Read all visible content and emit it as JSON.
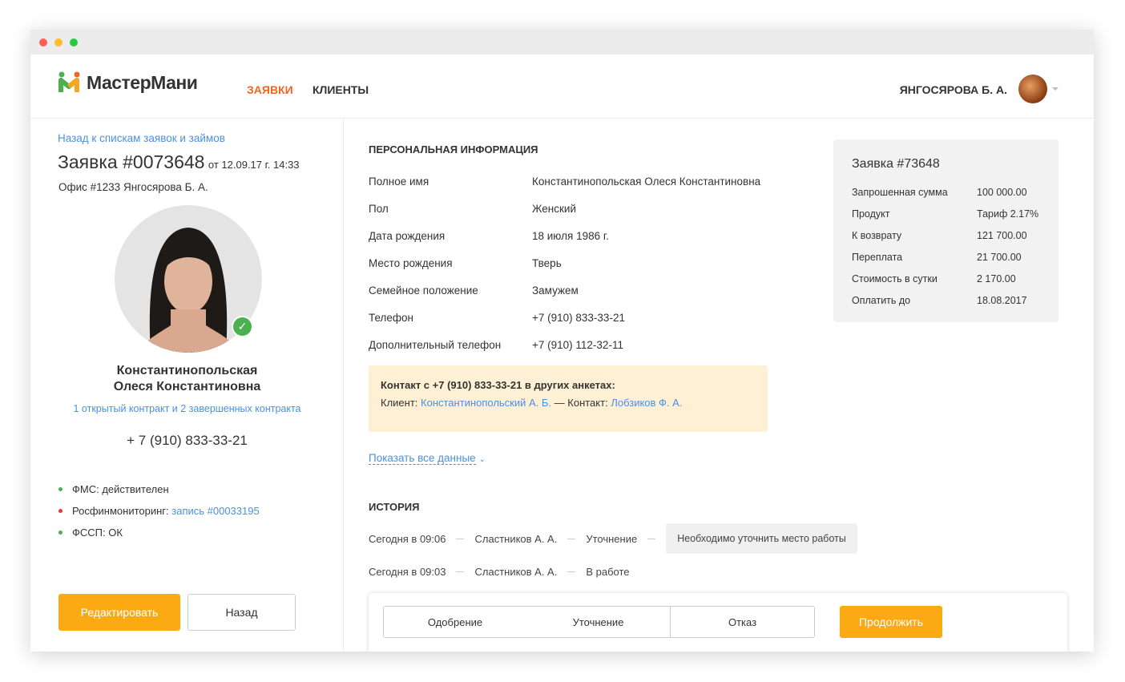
{
  "app": {
    "brand": "МастерМани",
    "nav": [
      {
        "label": "ЗАЯВКИ",
        "active": true
      },
      {
        "label": "КЛИЕНТЫ",
        "active": false
      }
    ],
    "user": "ЯНГОСЯРОВА Б. А.",
    "accent": "#f5a623",
    "nav_active_color": "#f26522"
  },
  "left": {
    "back_link": "Назад к спискам заявок и займов",
    "title": "Заявка #0073648",
    "date": "от 12.09.17 г. 14:33",
    "office": "Офис #1233 Янгосярова Б. А.",
    "name_line1": "Константинопольская",
    "name_line2": "Олеся Константиновна",
    "contracts_link": "1 открытый контракт и 2 завершенных контракта",
    "phone": "+ 7 (910) 833-33-21",
    "checks": [
      {
        "label": "ФМС: действителен",
        "link": "",
        "color": "#4caf50"
      },
      {
        "label": "Росфинмониторинг: ",
        "link": "запись #00033195",
        "color": "#e53935"
      },
      {
        "label": "ФССП: ОК",
        "link": "",
        "color": "#4caf50"
      }
    ],
    "edit_button": "Редактировать",
    "back_button": "Назад"
  },
  "personal": {
    "heading": "ПЕРСОНАЛЬНАЯ ИНФОРМАЦИЯ",
    "rows": [
      {
        "k": "Полное имя",
        "v": "Константинопольская Олеся Константиновна"
      },
      {
        "k": "Пол",
        "v": "Женский"
      },
      {
        "k": "Дата рождения",
        "v": "18 июля 1986 г."
      },
      {
        "k": "Место рождения",
        "v": "Тверь"
      },
      {
        "k": "Семейное положение",
        "v": "Замужем"
      },
      {
        "k": "Телефон",
        "v": "+7 (910) 833-33-21"
      },
      {
        "k": "Дополнительный телефон",
        "v": "+7 (910) 112-32-11"
      }
    ],
    "contact_title": "Контакт с +7 (910) 833-33-21 в других анкетах:",
    "client_label": "Клиент: ",
    "client_link": "Константинопольский А. Б.",
    "contact_label": " — Контакт: ",
    "contact_link": "Лобзиков Ф. А.",
    "show_all": "Показать все данные"
  },
  "card": {
    "title": "Заявка  #73648",
    "rows": [
      {
        "k": "Запрошенная сумма",
        "v": "100 000.00"
      },
      {
        "k": "Продукт",
        "v": "Тариф 2.17%"
      },
      {
        "k": "К возврату",
        "v": "121 700.00"
      },
      {
        "k": "Переплата",
        "v": "21 700.00"
      },
      {
        "k": "Стоимость в сутки",
        "v": "2 170.00"
      },
      {
        "k": "Оплатить до",
        "v": "18.08.2017"
      }
    ]
  },
  "history": {
    "heading": "ИСТОРИЯ",
    "items": [
      {
        "time": "Сегодня в 09:06",
        "who": "Сластников А. А.",
        "status": "Уточнение",
        "note": "Необходимо уточнить место работы"
      },
      {
        "time": "Сегодня в 09:03",
        "who": "Сластников А. А.",
        "status": "В работе"
      }
    ]
  },
  "actions": {
    "options": [
      "Одобрение",
      "Уточнение",
      "Отказ"
    ],
    "continue": "Продолжить"
  }
}
